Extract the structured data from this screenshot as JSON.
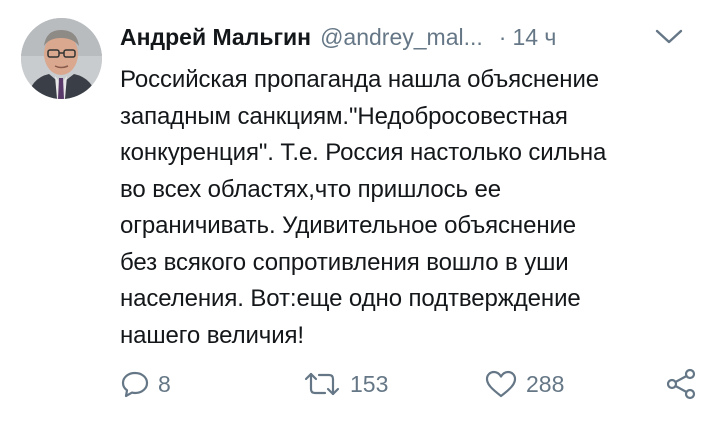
{
  "tweet": {
    "author_name": "Андрей Мальгин",
    "author_handle": "@andrey_mal...",
    "separator": "·",
    "time": "14 ч",
    "text": "Российская пропаганда нашла объяснение\nзападным санкциям.\"Недобросовестная\nконкуренция\". Т.е. Россия настолько сильна\nво всех областях,что пришлось ее\nограничивать. Удивительное объяснение\nбез всякого сопротивления вошло в уши\nнаселения. Вот:еще одно подтверждение\nнашего величия!",
    "actions": {
      "reply_count": "8",
      "retweet_count": "153",
      "like_count": "288"
    },
    "icons": {
      "avatar": "avatar-image",
      "more": "chevron-down-icon",
      "reply": "reply-icon",
      "retweet": "retweet-icon",
      "like": "heart-icon",
      "share": "share-icon"
    },
    "colors": {
      "text": "#14171a",
      "secondary": "#657786",
      "background": "#ffffff"
    }
  }
}
